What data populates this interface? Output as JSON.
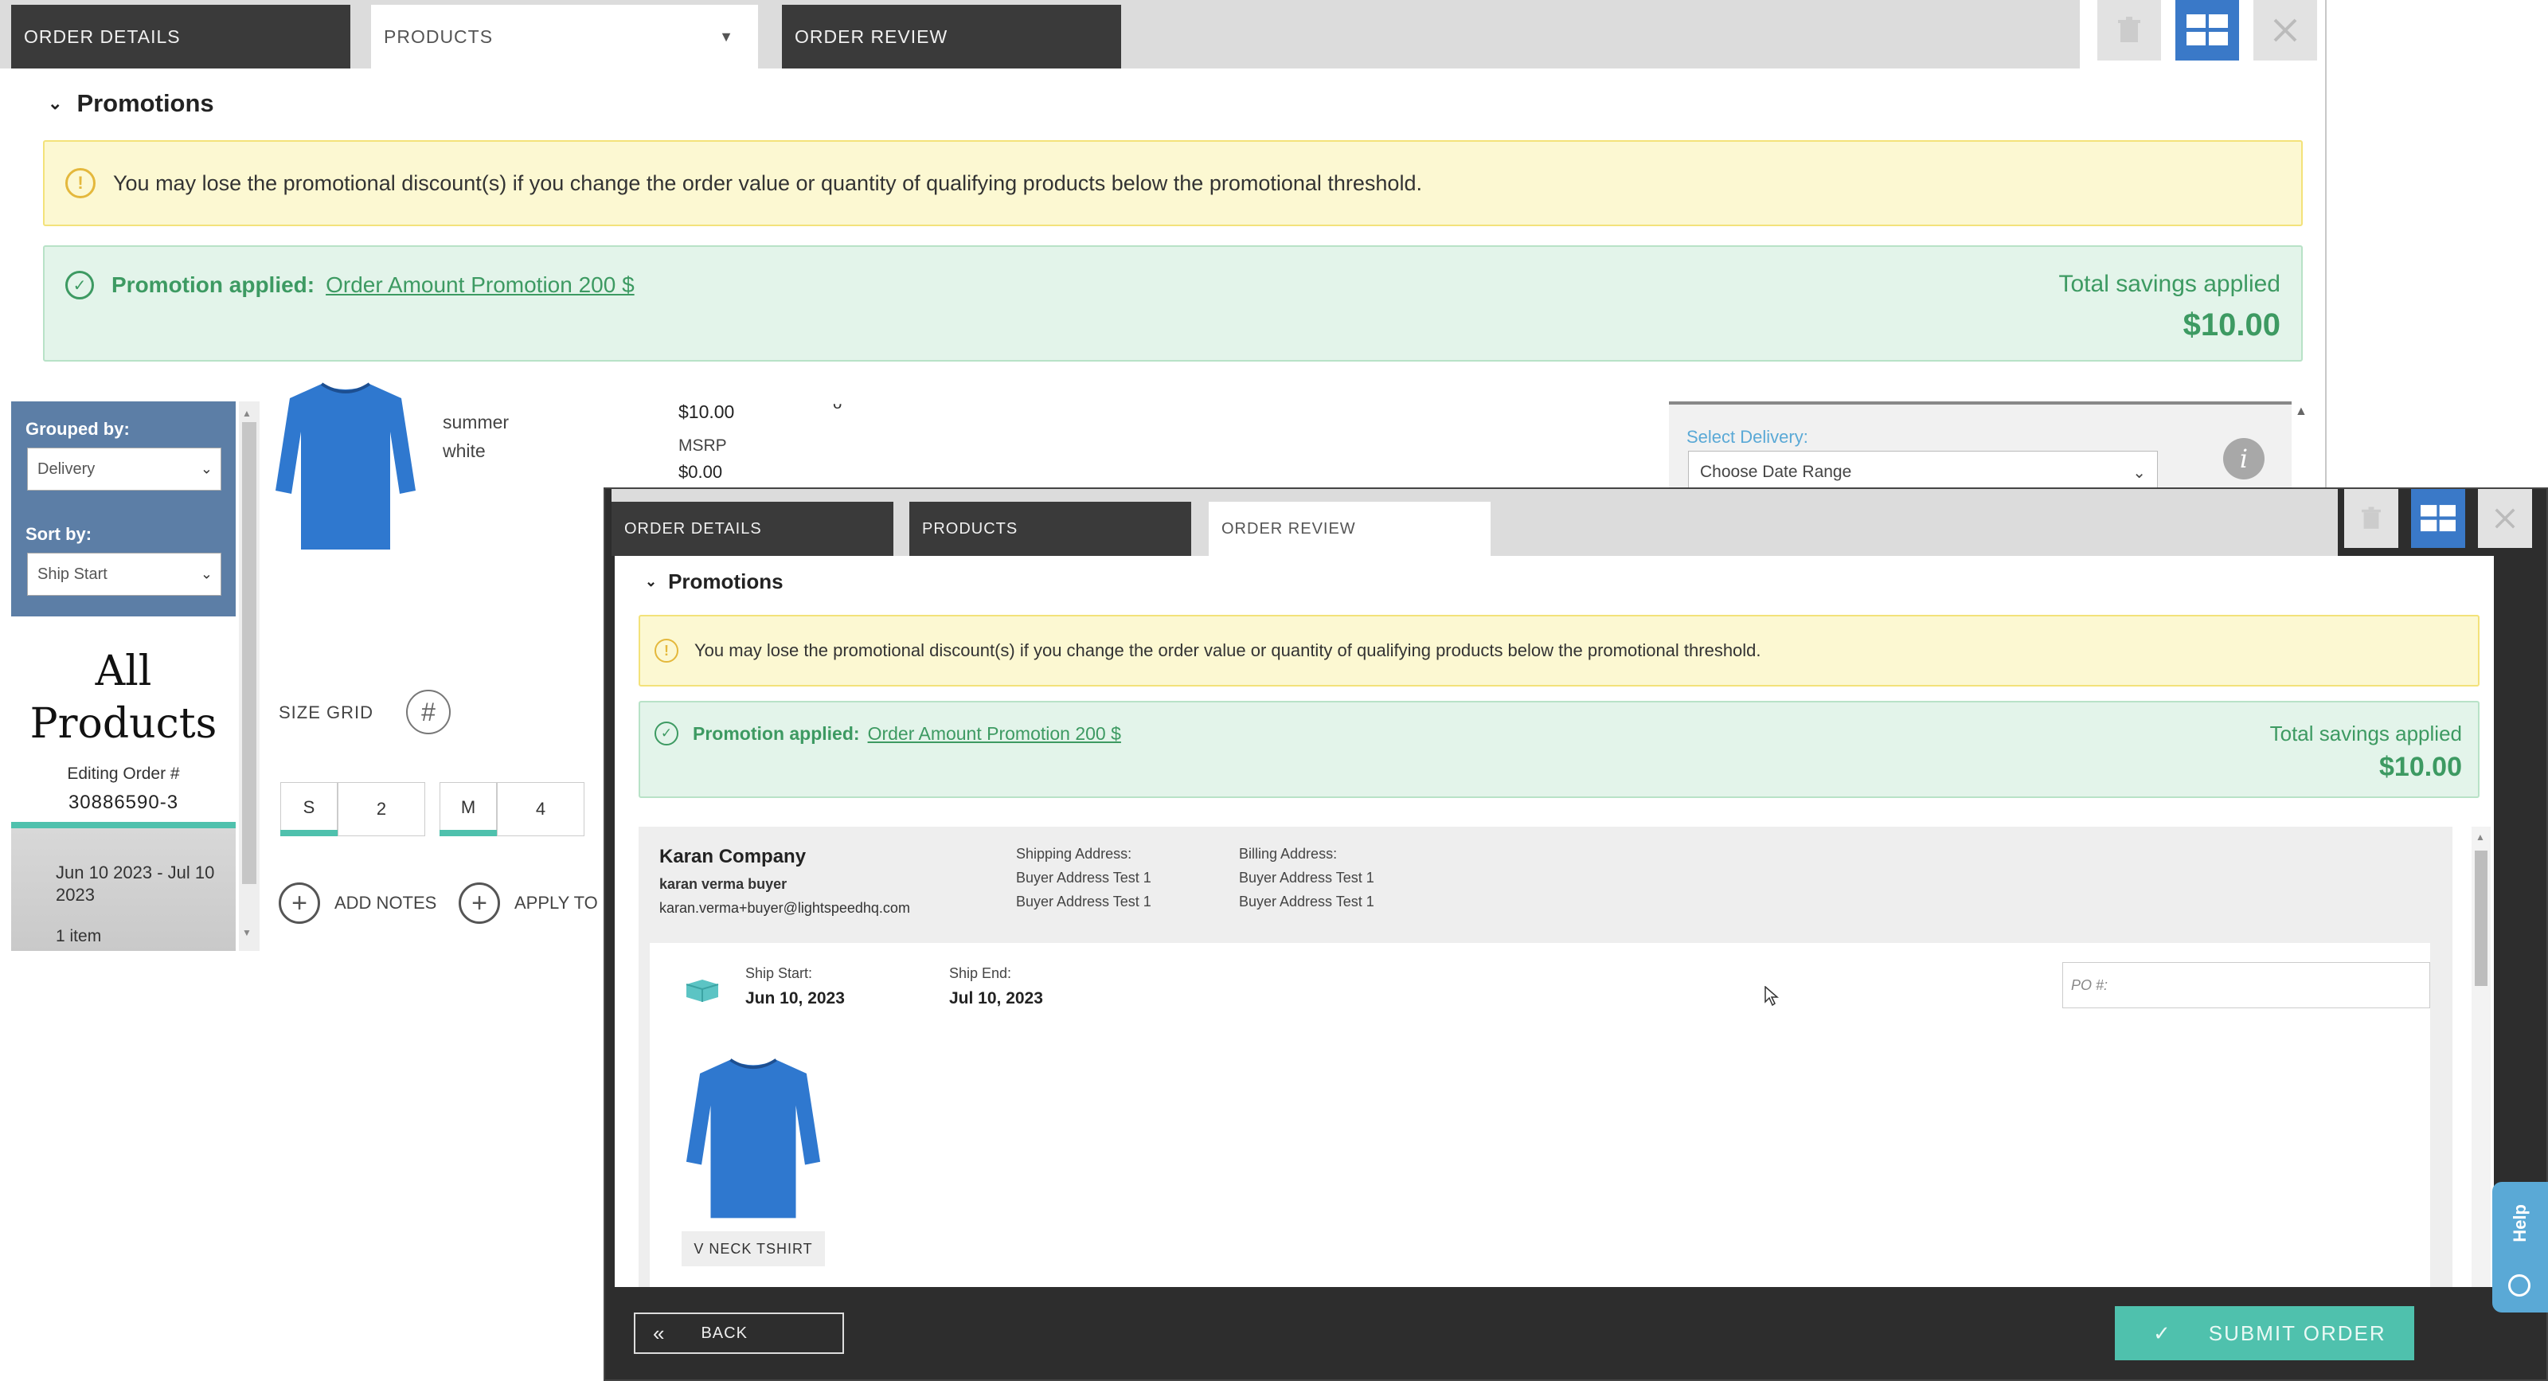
{
  "back_window": {
    "tabs": [
      {
        "label": "ORDER DETAILS"
      },
      {
        "label": "PRODUCTS"
      },
      {
        "label": "ORDER REVIEW"
      }
    ],
    "promotions": {
      "heading": "Promotions",
      "warning": "You may lose the promotional discount(s) if you change the order value or quantity of qualifying products below the promotional threshold.",
      "applied_label": "Promotion applied:",
      "applied_link": "Order Amount Promotion 200 $",
      "savings_label": "Total savings applied",
      "savings_amount": "$10.00"
    },
    "sidebar": {
      "grouped_by_label": "Grouped by:",
      "grouped_by_value": "Delivery",
      "sort_by_label": "Sort by:",
      "sort_by_value": "Ship Start",
      "all_products_line1": "All",
      "all_products_line2": "Products",
      "editing_label": "Editing Order #",
      "order_number": "30886590-3",
      "date_range": "Jun 10 2023 - Jul 10 2023",
      "item_count": "1 item"
    },
    "product": {
      "name_line1": "summer",
      "name_line2": "white",
      "price": "$10.00",
      "msrp_label": "MSRP",
      "msrp_value": "$0.00",
      "size_grid_label": "SIZE GRID",
      "sizes": [
        {
          "size": "S",
          "qty": "2"
        },
        {
          "size": "M",
          "qty": "4"
        }
      ],
      "add_notes": "ADD NOTES",
      "apply_to": "APPLY TO"
    },
    "delivery": {
      "label": "Select Delivery:",
      "placeholder": "Choose Date Range"
    }
  },
  "front_window": {
    "tabs": [
      {
        "label": "ORDER DETAILS"
      },
      {
        "label": "PRODUCTS"
      },
      {
        "label": "ORDER REVIEW"
      }
    ],
    "promotions": {
      "heading": "Promotions",
      "warning": "You may lose the promotional discount(s) if you change the order value or quantity of qualifying products below the promotional threshold.",
      "applied_label": "Promotion applied:",
      "applied_link": "Order Amount Promotion 200 $",
      "savings_label": "Total savings applied",
      "savings_amount": "$10.00"
    },
    "customer": {
      "company": "Karan Company",
      "buyer": "karan verma buyer",
      "email": "karan.verma+buyer@lightspeedhq.com",
      "shipping_label": "Shipping Address:",
      "shipping_line1": "Buyer Address Test 1",
      "shipping_line2": "Buyer Address Test 1",
      "billing_label": "Billing Address:",
      "billing_line1": "Buyer Address Test 1",
      "billing_line2": "Buyer Address Test 1"
    },
    "shipment": {
      "ship_start_label": "Ship Start:",
      "ship_start_value": "Jun 10, 2023",
      "ship_end_label": "Ship End:",
      "ship_end_value": "Jul 10, 2023",
      "po_placeholder": "PO #:",
      "product_name": "V NECK TSHIRT"
    },
    "footer": {
      "back_label": "BACK",
      "submit_label": "SUBMIT ORDER"
    },
    "help_label": "Help"
  },
  "colors": {
    "tab_dark": "#3a3a3a",
    "sidebar_blue": "#5c7ea6",
    "promo_green": "#3d9a62",
    "warn_yellow": "#fcf8d2",
    "submit_teal": "#4fc1ad",
    "shirt_blue": "#2f78cf"
  }
}
